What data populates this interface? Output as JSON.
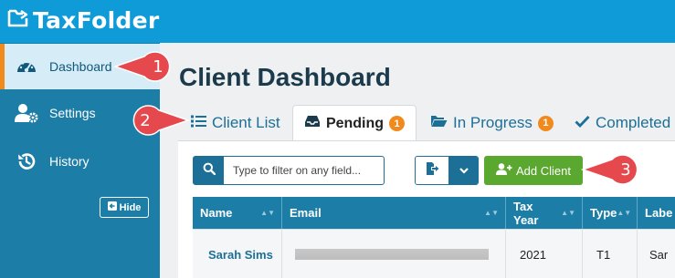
{
  "app": {
    "name": "TaxFolder",
    "brand_color": "#0e9bd8",
    "sidebar_color": "#1c7ea7",
    "accent_color": "#f08a1c"
  },
  "sidebar": {
    "items": [
      {
        "label": "Dashboard",
        "icon": "dashboard-gauge-icon",
        "active": true
      },
      {
        "label": "Settings",
        "icon": "user-gear-icon",
        "active": false
      },
      {
        "label": "History",
        "icon": "history-icon",
        "active": false
      }
    ],
    "hide_label": "Hide",
    "hide_icon": "arrow-left-square-icon"
  },
  "main": {
    "title": "Client Dashboard",
    "tabs": [
      {
        "label": "Client List",
        "icon": "list-icon",
        "active": false,
        "badge": null
      },
      {
        "label": "Pending",
        "icon": "inbox-icon",
        "active": true,
        "badge": "1"
      },
      {
        "label": "In Progress",
        "icon": "folder-open-icon",
        "active": false,
        "badge": "1"
      },
      {
        "label": "Completed",
        "icon": "check-icon",
        "active": false,
        "badge": null
      }
    ],
    "toolbar": {
      "search_placeholder": "Type to filter on any field...",
      "search_value": "",
      "add_client_label": "Add Client",
      "add_color": "#5aa82f"
    },
    "table": {
      "columns": [
        "Name",
        "Email",
        "Tax Year",
        "Type",
        "Labe"
      ],
      "rows": [
        {
          "name": "Sarah Sims",
          "email": "",
          "tax_year": "2021",
          "type": "T1",
          "label": "Sar"
        }
      ]
    }
  },
  "callouts": [
    "1",
    "2",
    "3"
  ],
  "callout_color": "#e5484d"
}
